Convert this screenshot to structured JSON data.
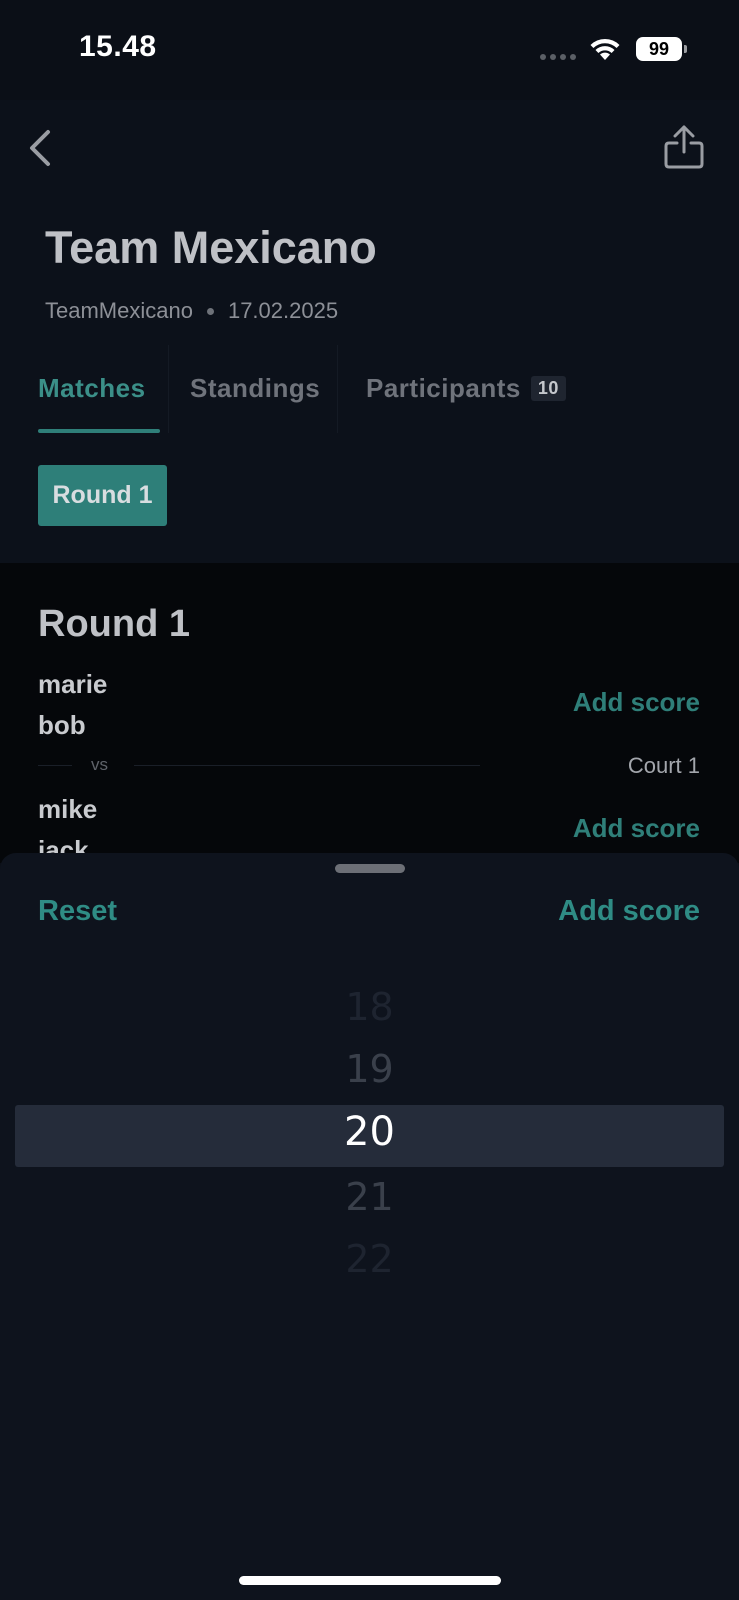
{
  "status_bar": {
    "time": "15.48",
    "battery": "99"
  },
  "header": {
    "title": "Team Mexicano",
    "organizer": "TeamMexicano",
    "date": "17.02.2025"
  },
  "tabs": [
    {
      "label": "Matches",
      "active": true
    },
    {
      "label": "Standings",
      "active": false
    },
    {
      "label": "Participants",
      "badge": "10",
      "active": false
    }
  ],
  "round_chip": "Round 1",
  "round": {
    "title": "Round 1",
    "team_a": [
      "marie",
      "bob"
    ],
    "team_b": [
      "mike",
      "jack"
    ],
    "add_score_label": "Add score",
    "vs_label": "vs",
    "court": "Court 1"
  },
  "sheet": {
    "reset_label": "Reset",
    "add_score_label": "Add score",
    "picker_values": [
      "18",
      "19",
      "20",
      "21",
      "22"
    ],
    "selected_value": "20"
  },
  "colors": {
    "accent": "#2f8c85",
    "background": "#0b0f17",
    "sheet": "#0e131d",
    "picker_highlight": "#252c3a"
  }
}
